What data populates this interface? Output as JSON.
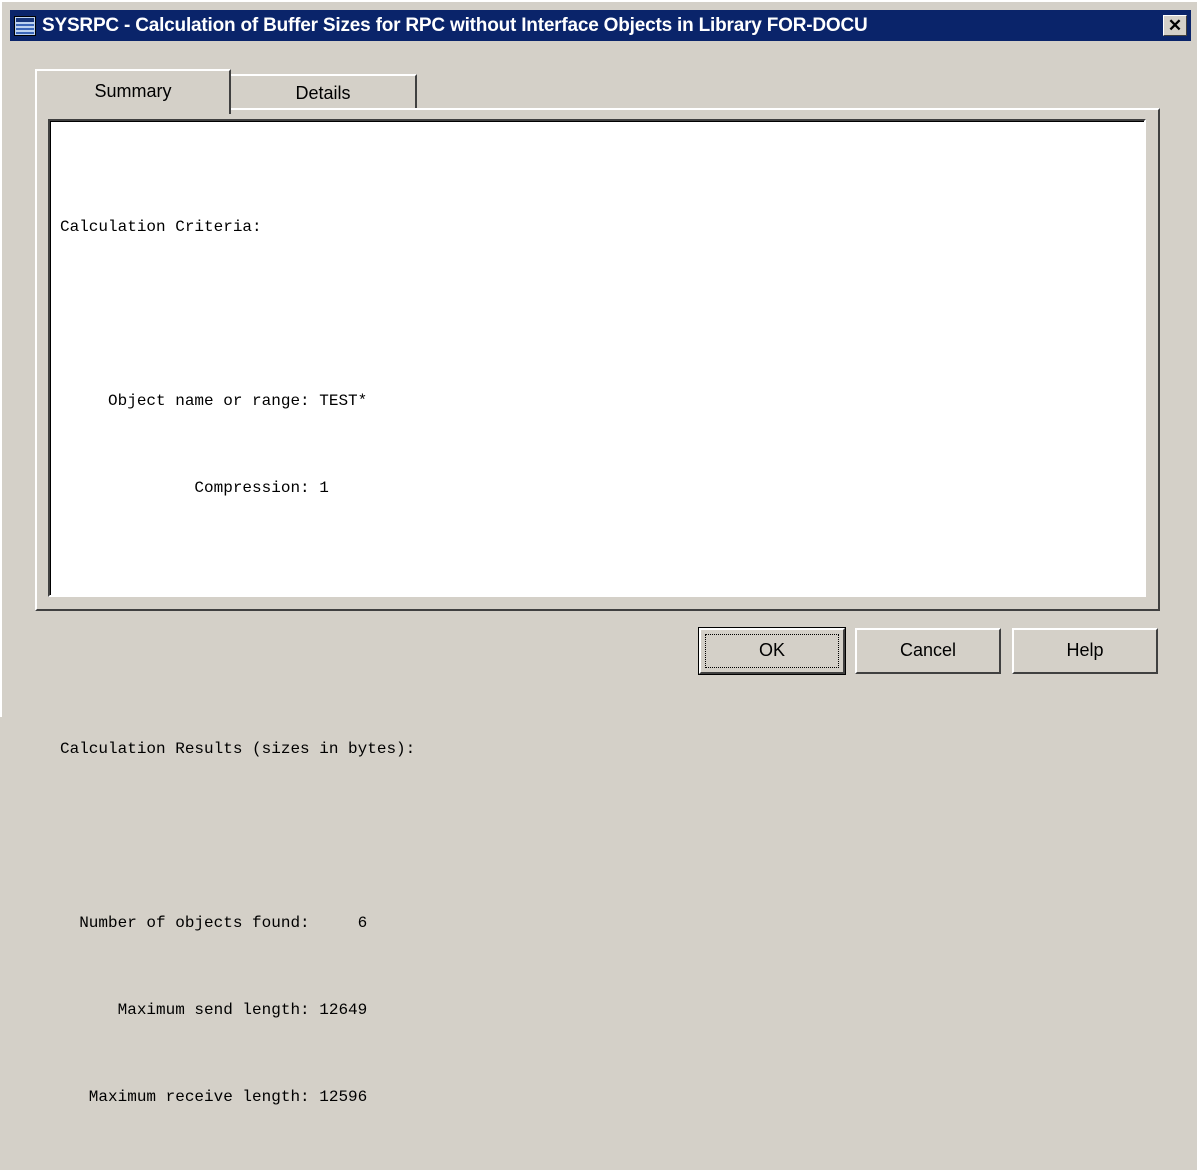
{
  "window": {
    "title": "SYSRPC - Calculation of Buffer Sizes for RPC without Interface Objects in Library FOR-DOCU",
    "close_glyph": "✕"
  },
  "tabs": [
    {
      "label": "Summary",
      "active": true
    },
    {
      "label": "Details",
      "active": false
    }
  ],
  "summary": {
    "criteria_heading": "Calculation Criteria:",
    "object_label": "     Object name or range: ",
    "object_value": "TEST*",
    "compression_label": "              Compression: ",
    "compression_value": "1",
    "results_heading": "Calculation Results (sizes in bytes):",
    "objects_found_label": "  Number of objects found: ",
    "objects_found_value": "    6",
    "max_send_label": "      Maximum send length: ",
    "max_send_value": "12649",
    "max_receive_label": "   Maximum receive length: ",
    "max_receive_value": "12596"
  },
  "buttons": {
    "ok": "OK",
    "cancel": "Cancel",
    "help": "Help"
  }
}
